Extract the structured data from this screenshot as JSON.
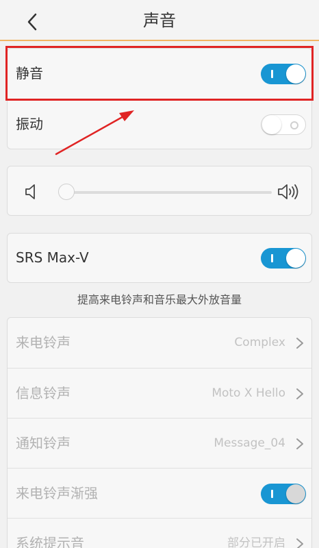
{
  "header": {
    "title": "声音",
    "back_icon": "chevron-left-icon"
  },
  "mute_card": {
    "mute": {
      "label": "静音",
      "enabled": true
    },
    "vibrate": {
      "label": "振动",
      "enabled": false
    }
  },
  "volume": {
    "level": 0.0
  },
  "srs_card": {
    "label": "SRS Max-V",
    "enabled": true
  },
  "srs_note": "提高来电铃声和音乐最大外放音量",
  "ringtones": {
    "rows": [
      {
        "label": "来电铃声",
        "value": "Complex"
      },
      {
        "label": "信息铃声",
        "value": "Moto X Hello"
      },
      {
        "label": "通知铃声",
        "value": "Message_04"
      },
      {
        "label": "来电铃声渐强",
        "toggle": true
      },
      {
        "label": "系统提示音",
        "value": "部分已开启"
      }
    ]
  },
  "colors": {
    "accent": "#1996d3",
    "header_border": "#f2b463",
    "annotation": "#e02424"
  }
}
